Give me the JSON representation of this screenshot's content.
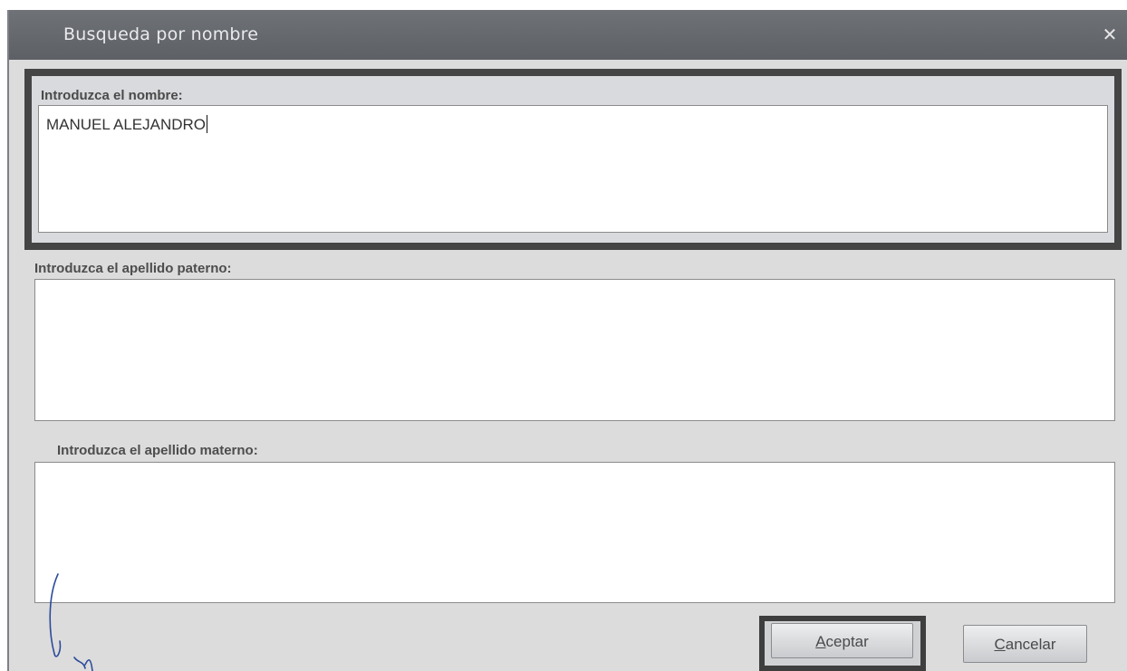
{
  "dialog": {
    "title": "Busqueda por nombre",
    "close_glyph": "✕"
  },
  "fields": {
    "nombre": {
      "label": "Introduzca el nombre:",
      "value": "MANUEL ALEJANDRO"
    },
    "apellido_paterno": {
      "label": "Introduzca el apellido paterno:",
      "value": ""
    },
    "apellido_materno": {
      "label": "Introduzca el apellido materno:",
      "value": ""
    }
  },
  "buttons": {
    "accept": {
      "label": "Aceptar",
      "accesskey": "A"
    },
    "cancel": {
      "label": "Cancelar",
      "accesskey": "C"
    }
  },
  "colors": {
    "titlebar": "#62656a",
    "dialog_background": "#dcdcdc",
    "focus_border": "#454546"
  },
  "icons": {
    "close": "close-icon"
  }
}
